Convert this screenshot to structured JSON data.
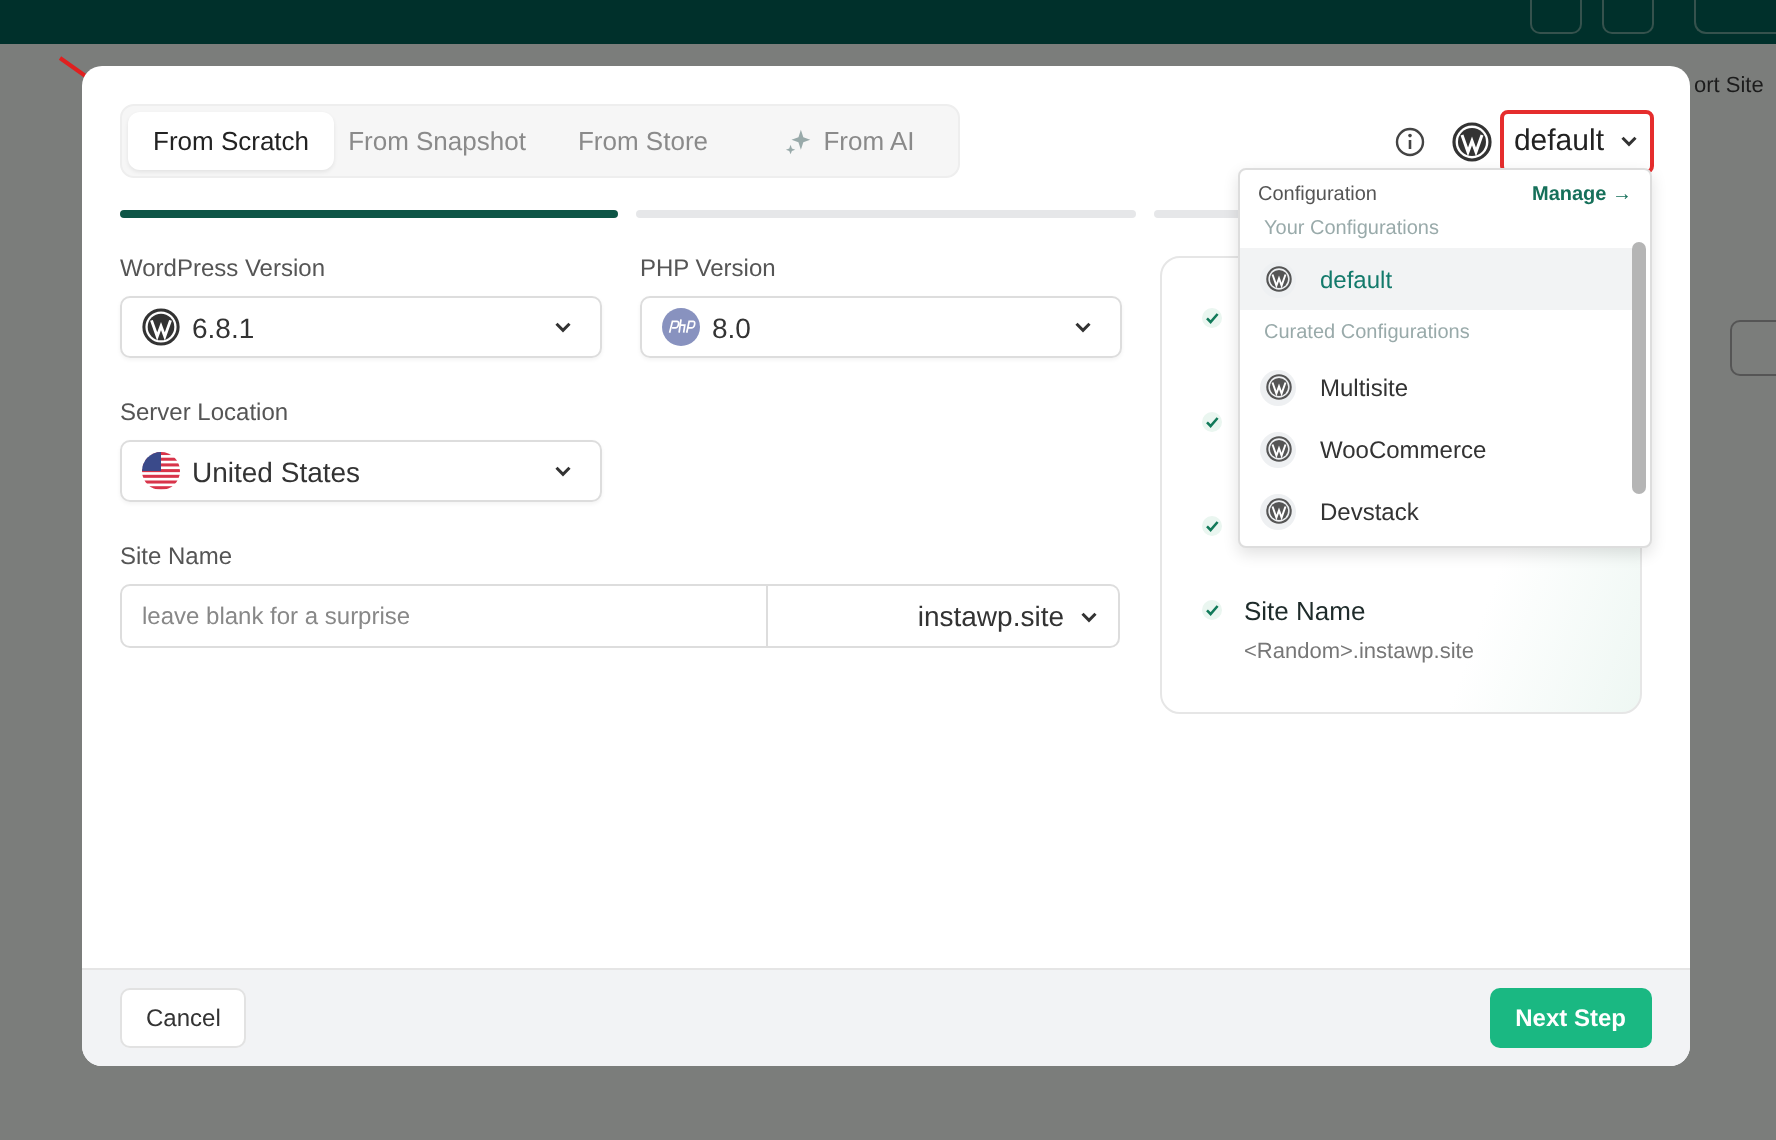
{
  "background": {
    "button_label": "ort Site"
  },
  "tabs": [
    {
      "label": "From Scratch",
      "selected": true,
      "kind": "plain"
    },
    {
      "label": "From Snapshot",
      "selected": false,
      "kind": "plain"
    },
    {
      "label": "From Store",
      "selected": false,
      "kind": "plain"
    },
    {
      "label": "From AI",
      "selected": false,
      "kind": "ai"
    }
  ],
  "config_button": {
    "label": "default",
    "highlighted": true
  },
  "steps": [
    {
      "level": 1
    },
    {
      "level": 0
    },
    {
      "level": 0
    }
  ],
  "fields": [
    {
      "label": "WordPress Version",
      "value": "6.8.1",
      "kind": "wordpress"
    },
    {
      "label": "PHP Version",
      "value": "8.0",
      "kind": "php"
    },
    {
      "label": "Server Location",
      "value": "United States",
      "kind": "flag"
    }
  ],
  "site_name": {
    "label": "Site Name",
    "placeholder": "leave blank for a surprise",
    "domain": "instawp.site"
  },
  "summary": [
    {
      "done": true
    },
    {
      "done": true
    },
    {
      "done": true
    },
    {
      "done": true,
      "title": "Site Name",
      "detail": "<Random>.instawp.site"
    }
  ],
  "dropdown": {
    "title": "Configuration",
    "link": "Manage →",
    "groups": [
      {
        "heading": "Your Configurations",
        "items": [
          {
            "label": "default",
            "selected": true
          }
        ]
      },
      {
        "heading": "Curated Configurations",
        "items": [
          {
            "label": "Multisite",
            "selected": false
          },
          {
            "label": "WooCommerce",
            "selected": false
          },
          {
            "label": "Devstack",
            "selected": false
          }
        ]
      }
    ]
  },
  "footer": {
    "cancel": "Cancel",
    "next": "Next Step"
  }
}
